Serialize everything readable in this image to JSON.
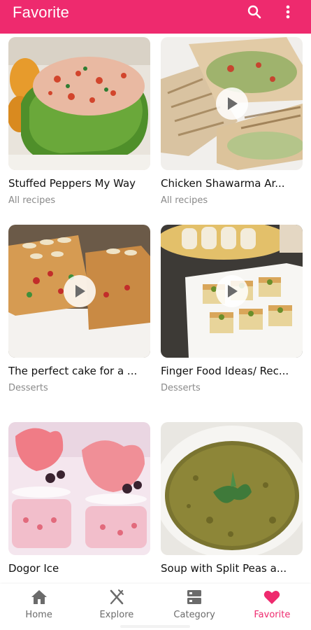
{
  "appbar": {
    "title": "Favorite",
    "search_icon": "search-icon",
    "menu_icon": "more-vert-icon",
    "color": "#ee2a6e"
  },
  "recipes": [
    {
      "name": "Stuffed Peppers My Way",
      "category": "All recipes",
      "has_video": false
    },
    {
      "name": "Chicken Shawarma Ar...",
      "category": "All recipes",
      "has_video": true
    },
    {
      "name": "The perfect cake for a ...",
      "category": "Desserts",
      "has_video": true
    },
    {
      "name": "Finger Food Ideas/ Rec...",
      "category": "Desserts",
      "has_video": true
    },
    {
      "name": "Dogor Ice",
      "category": "",
      "has_video": false
    },
    {
      "name": "Soup with Split Peas a...",
      "category": "",
      "has_video": false
    }
  ],
  "nav": [
    {
      "label": "Home",
      "icon": "home-icon",
      "active": false
    },
    {
      "label": "Explore",
      "icon": "fork-knife-icon",
      "active": false
    },
    {
      "label": "Category",
      "icon": "category-icon",
      "active": false
    },
    {
      "label": "Favorite",
      "icon": "heart-icon",
      "active": true
    }
  ]
}
